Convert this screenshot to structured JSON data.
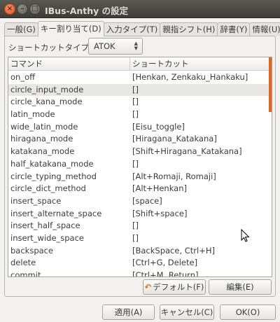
{
  "window": {
    "title": "IBus-Anthy の設定",
    "controls": {
      "close": "×",
      "minimize": "–",
      "maximize": "□"
    }
  },
  "tabs": [
    {
      "label": "一般(G)",
      "active": false
    },
    {
      "label": "キー割り当て(D)",
      "active": true
    },
    {
      "label": "入力タイプ(T)",
      "active": false
    },
    {
      "label": "親指シフト(H)",
      "active": false
    },
    {
      "label": "辞書(Y)",
      "active": false
    },
    {
      "label": "情報(U)",
      "active": false
    }
  ],
  "shortcut_type": {
    "label": "ショートカットタイプ(S):",
    "value": "ATOK"
  },
  "table": {
    "columns": [
      "コマンド",
      "ショートカット"
    ],
    "selected_row": 1,
    "rows": [
      {
        "command": "on_off",
        "shortcut": "[Henkan, Zenkaku_Hankaku]"
      },
      {
        "command": "circle_input_mode",
        "shortcut": "[]"
      },
      {
        "command": "circle_kana_mode",
        "shortcut": "[]"
      },
      {
        "command": "latin_mode",
        "shortcut": "[]"
      },
      {
        "command": "wide_latin_mode",
        "shortcut": "[Eisu_toggle]"
      },
      {
        "command": "hiragana_mode",
        "shortcut": "[Hiragana_Katakana]"
      },
      {
        "command": "katakana_mode",
        "shortcut": "[Shift+Hiragana_Katakana]"
      },
      {
        "command": "half_katakana_mode",
        "shortcut": "[]"
      },
      {
        "command": "circle_typing_method",
        "shortcut": "[Alt+Romaji, Romaji]"
      },
      {
        "command": "circle_dict_method",
        "shortcut": "[Alt+Henkan]"
      },
      {
        "command": "insert_space",
        "shortcut": "[space]"
      },
      {
        "command": "insert_alternate_space",
        "shortcut": "[Shift+space]"
      },
      {
        "command": "insert_half_space",
        "shortcut": "[]"
      },
      {
        "command": "insert_wide_space",
        "shortcut": "[]"
      },
      {
        "command": "backspace",
        "shortcut": "[BackSpace, Ctrl+H]"
      },
      {
        "command": "delete",
        "shortcut": "[Ctrl+G, Delete]"
      },
      {
        "command": "commit",
        "shortcut": "[Ctrl+M, Return]"
      }
    ]
  },
  "buttons": {
    "default": "デフォルト(F)",
    "edit": "編集(E)",
    "apply": "適用(A)",
    "cancel": "キャンセル(C)",
    "ok": "OK(O)"
  },
  "colors": {
    "accent": "#e8641b",
    "selection": "#e9e7e4"
  }
}
